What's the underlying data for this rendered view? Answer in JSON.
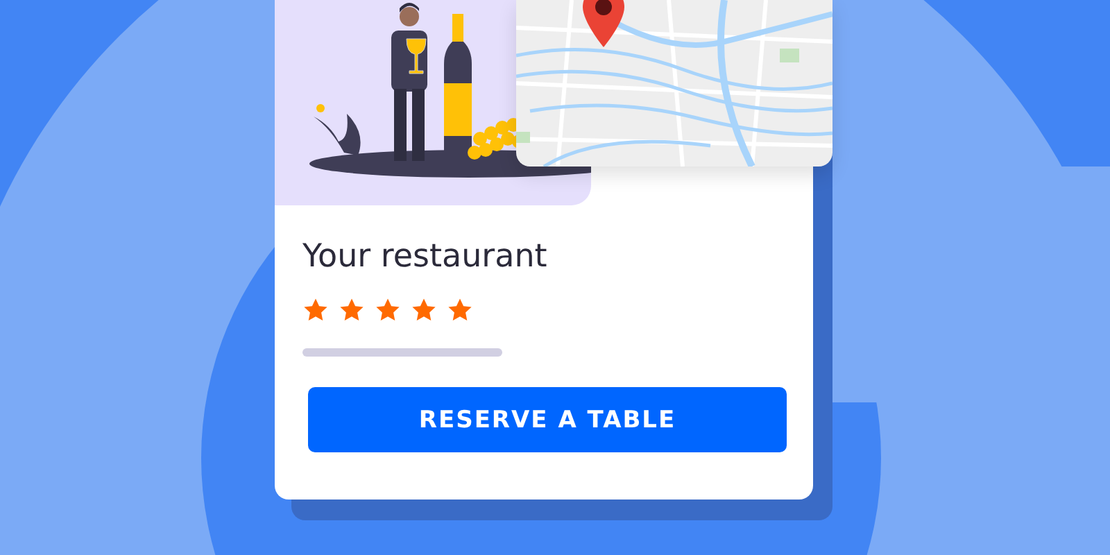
{
  "card": {
    "title": "Your restaurant",
    "stars": 5,
    "button": "RESERVE A TABLE"
  }
}
